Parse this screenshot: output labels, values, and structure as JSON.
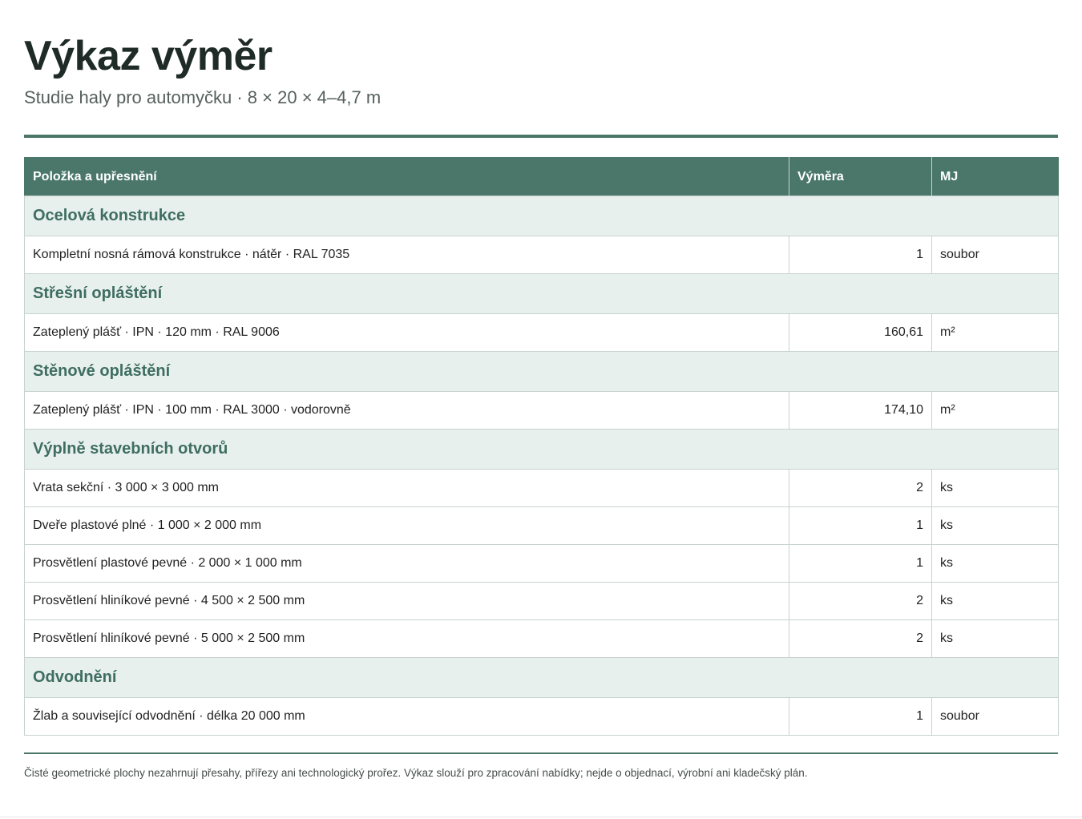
{
  "header": {
    "title": "Výkaz výměr",
    "subtitle": "Studie haly pro automyčku · 8 × 20 × 4–4,7 m"
  },
  "table": {
    "columns": [
      "Položka a upřesnění",
      "Výměra",
      "MJ"
    ],
    "sections": [
      {
        "title": "Ocelová konstrukce",
        "rows": [
          {
            "item": "Kompletní nosná rámová konstrukce · nátěr · RAL 7035",
            "qty": "1",
            "unit": "soubor"
          }
        ]
      },
      {
        "title": "Střešní opláštění",
        "rows": [
          {
            "item": "Zateplený plášť · IPN · 120 mm · RAL 9006",
            "qty": "160,61",
            "unit": "m²"
          }
        ]
      },
      {
        "title": "Stěnové opláštění",
        "rows": [
          {
            "item": "Zateplený plášť · IPN · 100 mm · RAL 3000 · vodorovně",
            "qty": "174,10",
            "unit": "m²"
          }
        ]
      },
      {
        "title": "Výplně stavebních otvorů",
        "rows": [
          {
            "item": "Vrata sekční · 3 000 × 3 000 mm",
            "qty": "2",
            "unit": "ks"
          },
          {
            "item": "Dveře plastové plné · 1 000 × 2 000 mm",
            "qty": "1",
            "unit": "ks"
          },
          {
            "item": "Prosvětlení plastové pevné · 2 000 × 1 000 mm",
            "qty": "1",
            "unit": "ks"
          },
          {
            "item": "Prosvětlení hliníkové pevné · 4 500 × 2 500 mm",
            "qty": "2",
            "unit": "ks"
          },
          {
            "item": "Prosvětlení hliníkové pevné · 5 000 × 2 500 mm",
            "qty": "2",
            "unit": "ks"
          }
        ]
      },
      {
        "title": "Odvodnění",
        "rows": [
          {
            "item": "Žlab a související odvodnění · délka 20 000 mm",
            "qty": "1",
            "unit": "soubor"
          }
        ]
      }
    ]
  },
  "footnote": "Čisté geometrické plochy nezahrnují přesahy, přířezy ani technologický prořez. Výkaz slouží pro zpracování nabídky; nejde o objednací, výrobní ani kladečský plán.",
  "colors": {
    "accent": "#4a7769",
    "section_bg": "#e8f0ee",
    "section_text": "#3f6e60"
  }
}
